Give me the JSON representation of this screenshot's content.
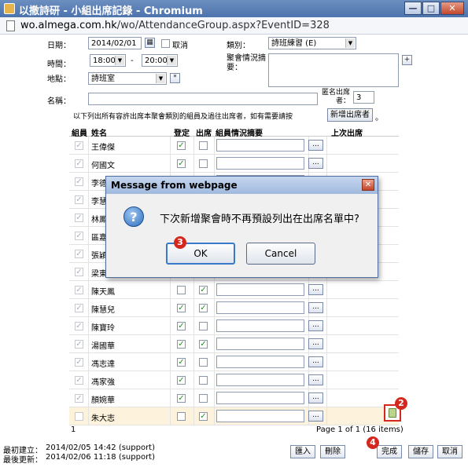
{
  "window": {
    "title": "以撒詩研 - 小組出席記錄 - Chromium",
    "url_host": "wo.almega.com.hk",
    "url_path": "/wo/AttendanceGroup.aspx?EventID=328",
    "minimize": "—",
    "maximize": "□",
    "close": "✕"
  },
  "form": {
    "date_label": "日期：",
    "date_value": "2014/02/01",
    "cancel_label": "取消",
    "time_label": "時間：",
    "time_start": "18:00",
    "time_sep": "-",
    "time_end": "20:00",
    "place_label": "地點：",
    "place_value": "詩班室",
    "category_label": "類別：",
    "category_value": "詩班練習 (E)",
    "summary_label": "聚會情況摘要：",
    "name_label": "名稱：",
    "anon_label": "匿名出席者：",
    "anon_value": "3",
    "hint_text": "以下列出所有容許出席本聚會類別的組員及過往出席者，如有需要請按",
    "add_attendee_button": "新增出席者",
    "hint_tail": "。",
    "plus": "+",
    "star": "*"
  },
  "grid": {
    "headers": [
      "組員",
      "姓名",
      "登定",
      "出席",
      "組員情況摘要",
      "上次出席"
    ],
    "dots": "...",
    "rows": [
      {
        "name": "王偉傑",
        "member": true,
        "reg": true,
        "att": false
      },
      {
        "name": "何國文",
        "member": true,
        "reg": true,
        "att": false
      },
      {
        "name": "李德",
        "member": true,
        "reg": true,
        "att": false
      },
      {
        "name": "李慧",
        "member": true,
        "reg": true,
        "att": false
      },
      {
        "name": "林鳳",
        "member": true,
        "reg": true,
        "att": false
      },
      {
        "name": "區嘉",
        "member": true,
        "reg": true,
        "att": false
      },
      {
        "name": "張穎",
        "member": true,
        "reg": true,
        "att": false
      },
      {
        "name": "梁東",
        "member": true,
        "reg": true,
        "att": false
      },
      {
        "name": "陳天鳳",
        "member": true,
        "reg": false,
        "att": true
      },
      {
        "name": "陳慧兒",
        "member": true,
        "reg": true,
        "att": true
      },
      {
        "name": "陳寶玲",
        "member": true,
        "reg": true,
        "att": false
      },
      {
        "name": "湯國華",
        "member": true,
        "reg": true,
        "att": true
      },
      {
        "name": "馮志達",
        "member": true,
        "reg": true,
        "att": false
      },
      {
        "name": "馮家強",
        "member": true,
        "reg": true,
        "att": false
      },
      {
        "name": "顏婉華",
        "member": true,
        "reg": true,
        "att": false
      },
      {
        "name": "朱大志",
        "member": false,
        "reg": false,
        "att": true
      }
    ],
    "page_index": "1",
    "pager": "Page 1 of 1 (16 items)"
  },
  "footer": {
    "created_label": "最初建立：",
    "created_value": "2014/02/05 14:42 (support)",
    "updated_label": "最後更新：",
    "updated_value": "2014/02/06 11:18 (support)",
    "import_button": "匯入",
    "delete_button": "刪除",
    "done_button": "完成",
    "save_button": "儲存",
    "cancel_button": "取消"
  },
  "dialog": {
    "title": "Message from webpage",
    "message": "下次新增聚會時不再預設列出在出席名單中?",
    "ok_button": "OK",
    "cancel_button": "Cancel",
    "close": "✕",
    "question_glyph": "?"
  },
  "markers": {
    "m2": "2",
    "m3": "3",
    "m4": "4"
  },
  "colors": {
    "marker": "#d4281e",
    "selected_row": "#fdf2dc",
    "titlebar": "#4d73ad"
  }
}
